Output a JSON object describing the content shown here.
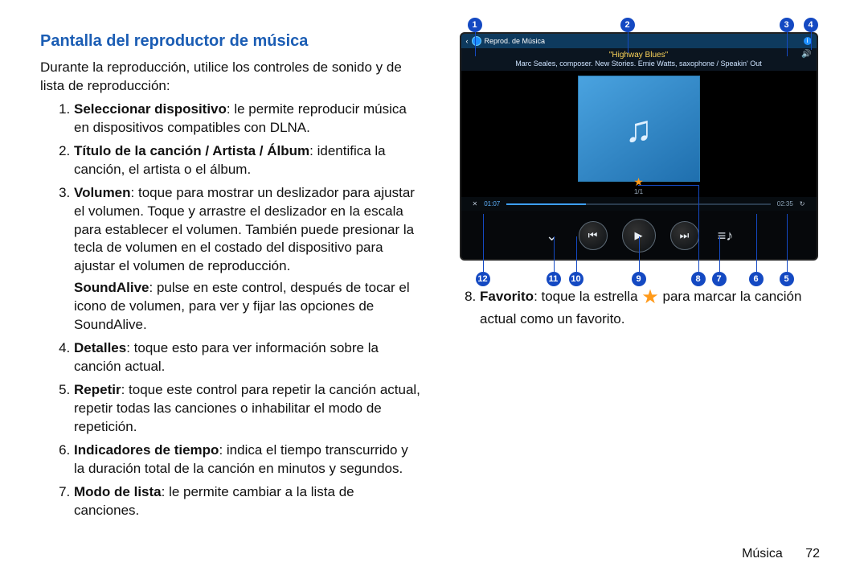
{
  "section_title": "Pantalla del reproductor de música",
  "intro": "Durante la reproducción, utilice los controles de sonido y de lista de reproducción:",
  "items_left": [
    {
      "head": "Seleccionar dispositivo",
      "body": ": le permite reproducir música en dispositivos compatibles con DLNA."
    },
    {
      "head": "Título de la canción / Artista / Álbum",
      "body": ": identifica la canción, el artista o el álbum."
    },
    {
      "head": "Volumen",
      "body": ": toque para mostrar un deslizador para ajustar el volumen. Toque y arrastre el deslizador en la escala para establecer el volumen. También puede presionar la tecla de volumen en el costado del dispositivo para ajustar el volumen de reproducción.",
      "sub_head": "SoundAlive",
      "sub_body": ": pulse en este control, después de tocar el icono de volumen, para ver y fijar las opciones de SoundAlive."
    },
    {
      "head": "Detalles",
      "body": ": toque esto para ver información sobre la canción actual."
    },
    {
      "head": "Repetir",
      "body": ": toque este control para repetir la canción actual, repetir todas las canciones o inhabilitar el modo de repetición."
    },
    {
      "head": "Indicadores de tiempo",
      "body": ": indica el tiempo transcurrido y la duración total de la canción en minutos y segundos."
    },
    {
      "head": "Modo de lista",
      "body": ": le permite cambiar a la lista de canciones."
    }
  ],
  "right_item": {
    "num": "8.",
    "head": "Favorito",
    "body_a": ": toque la estrella ",
    "body_b": " para marcar la canción actual como un favorito."
  },
  "player": {
    "back": "‹",
    "title": "Reprod. de Música",
    "song": "\"Highway Blues\"",
    "artist": "Marc Seales, composer. New Stories. Ernie Watts, saxophone / Speakin' Out",
    "page_indicator": "1/1",
    "elapsed": "01:07",
    "total": "02:35",
    "note_glyph": "♫",
    "star_glyph": "★",
    "info_glyph": "i",
    "vol_glyph": "🔊",
    "shuffle_glyph": "✕",
    "repeat_glyph": "↻",
    "chev_glyph": "⌄",
    "prev_glyph": "⏮",
    "play_glyph": "▶",
    "next_glyph": "⏭",
    "list_glyph": "≡♪"
  },
  "callouts_top": [
    "1",
    "2",
    "3",
    "4"
  ],
  "callouts_bottom": [
    "12",
    "11",
    "10",
    "9",
    "8",
    "7",
    "6",
    "5"
  ],
  "footer": {
    "label": "Música",
    "page": "72"
  }
}
